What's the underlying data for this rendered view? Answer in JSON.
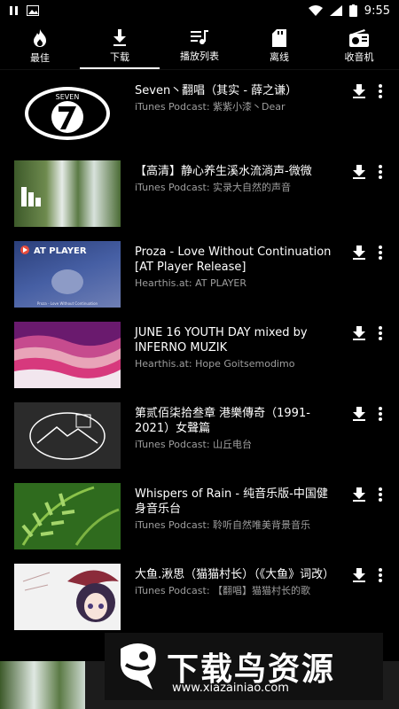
{
  "status": {
    "time": "9:55"
  },
  "tabs": [
    {
      "label": "最佳",
      "icon": "flame-icon"
    },
    {
      "label": "下载",
      "icon": "download-icon",
      "active": true
    },
    {
      "label": "播放列表",
      "icon": "playlist-icon"
    },
    {
      "label": "离线",
      "icon": "sd-card-icon"
    },
    {
      "label": "收音机",
      "icon": "radio-icon"
    }
  ],
  "items": [
    {
      "title": "Seven丶翻唱（其实 - 薛之谦）",
      "subtitle": "iTunes Podcast: 紫紫小漆丶Dear"
    },
    {
      "title": "【高清】静心养生溪水流淌声-微微",
      "subtitle": "iTunes Podcast: 实录大自然的声音"
    },
    {
      "title": "Proza - Love Without Continuation [AT Player Release]",
      "subtitle": "Hearthis.at: AT PLAYER"
    },
    {
      "title": "JUNE 16 YOUTH DAY mixed by INFERNO MUZIK",
      "subtitle": "Hearthis.at: Hope Goitsemodimo"
    },
    {
      "title": "第贰佰柒拾叁章 港樂傳奇（1991-2021）女聲篇",
      "subtitle": "iTunes Podcast: 山丘电台"
    },
    {
      "title": "Whispers of Rain - 纯音乐版-中国健身音乐台",
      "subtitle": "iTunes Podcast: 聆听自然唯美背景音乐"
    },
    {
      "title": "大鱼.湫思（猫猫村长）（《大鱼》词改）",
      "subtitle": "iTunes Podcast: 【翻唱】猫猫村长的歌"
    }
  ],
  "thumb_text": {
    "seven": "SEVEN",
    "at_player": "AT PLAYER",
    "proza": "Proza - Love Without Continuation"
  },
  "watermark": {
    "text": "下载鸟资源",
    "url": "www.xiazainiao.com"
  }
}
